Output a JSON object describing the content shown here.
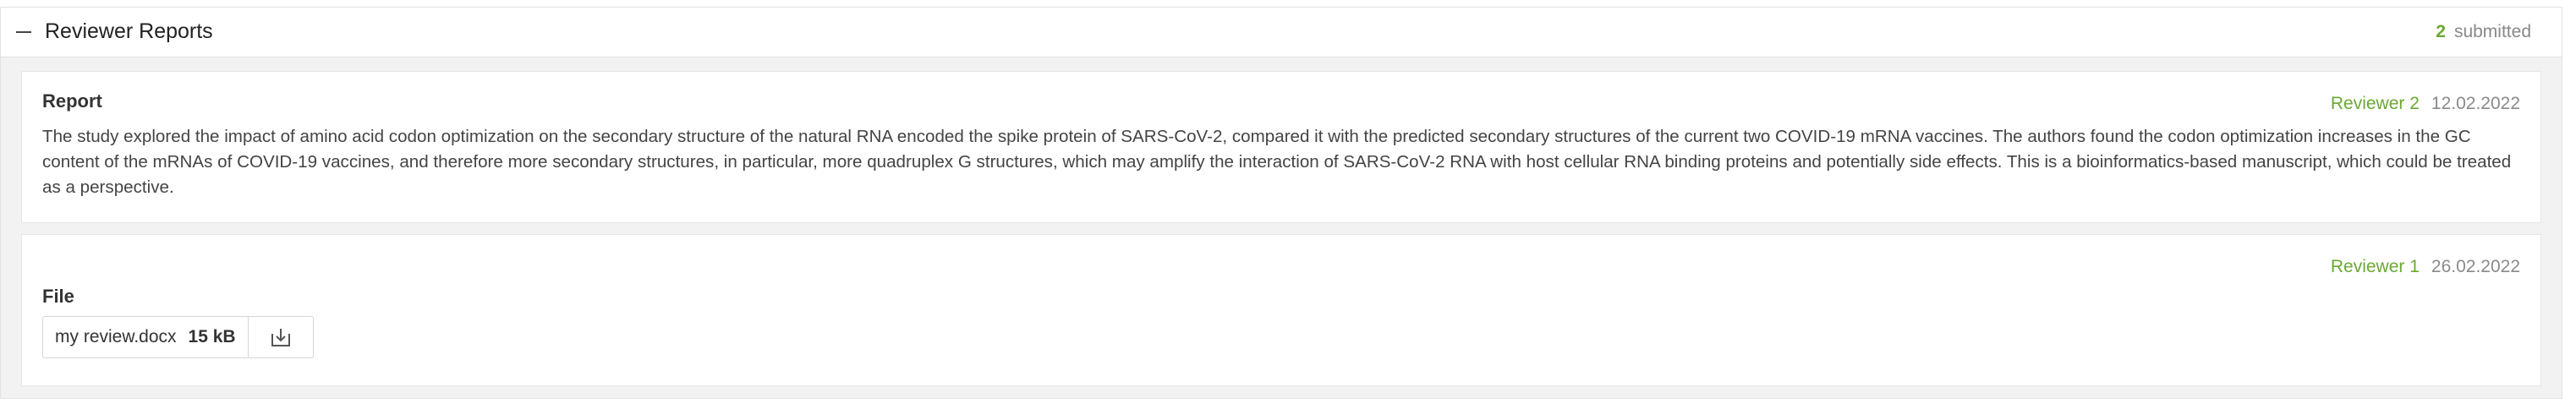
{
  "panel": {
    "title": "Reviewer Reports",
    "submitted_count": "2",
    "submitted_label": "submitted"
  },
  "reports": [
    {
      "label": "Report",
      "reviewer": "Reviewer 2",
      "date": "12.02.2022",
      "text": "The study explored the impact of amino acid codon optimization on the secondary structure of the natural RNA encoded the spike protein of SARS-CoV-2, compared it with the predicted secondary structures of the current two COVID-19 mRNA vaccines. The authors found the codon optimization increases in the GC content of the mRNAs of COVID-19 vaccines, and therefore more secondary structures, in particular, more quadruplex G structures, which may amplify the interaction of SARS-CoV-2 RNA with host cellular RNA binding proteins and potentially side effects. This is a bioinformatics-based manuscript, which could be treated as a perspective."
    },
    {
      "label": "File",
      "reviewer": "Reviewer 1",
      "date": "26.02.2022",
      "file_name": "my review.docx",
      "file_size": "15 kB"
    }
  ],
  "icons": {
    "collapse": "minus-icon",
    "download": "download-icon"
  },
  "colors": {
    "accent": "#6aa932",
    "muted": "#8a8a8a"
  }
}
